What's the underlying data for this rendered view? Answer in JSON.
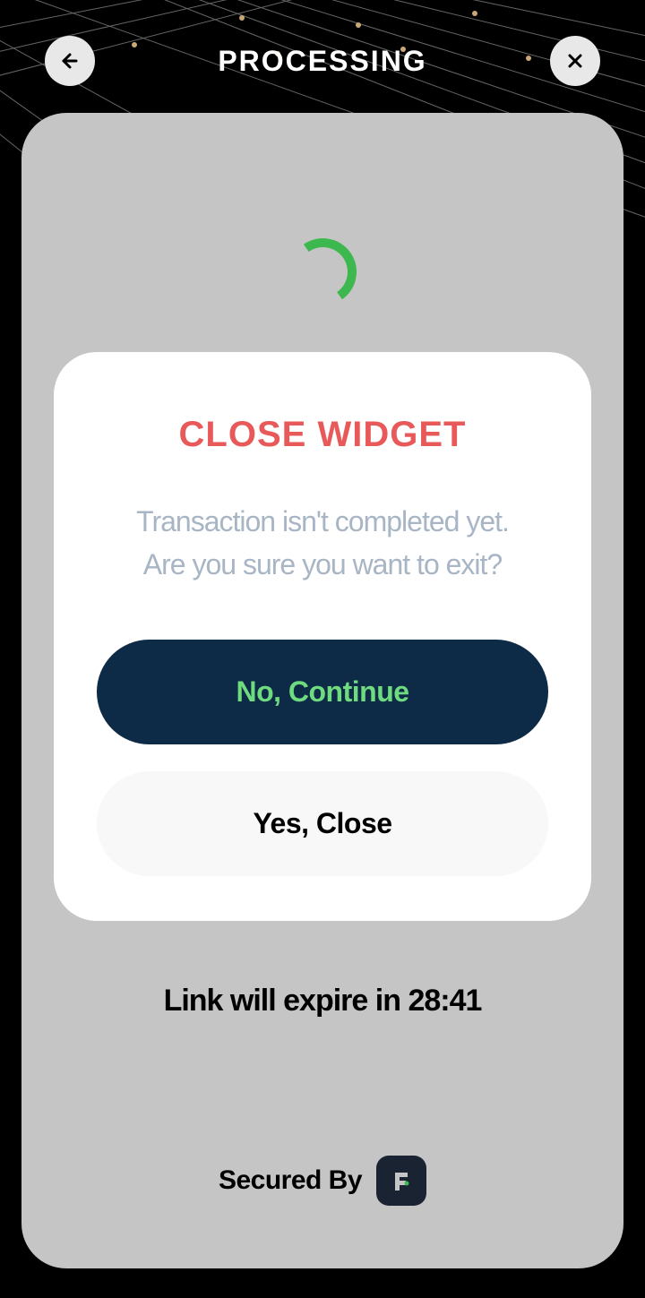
{
  "header": {
    "title": "PROCESSING"
  },
  "modal": {
    "title": "CLOSE WIDGET",
    "message_line1": "Transaction isn't completed yet.",
    "message_line2": "Are you sure you want to exit?",
    "btn_continue": "No, Continue",
    "btn_close": "Yes, Close"
  },
  "expire": {
    "prefix": "Link will expire in ",
    "time": "28:41"
  },
  "footer": {
    "secured_by": "Secured By"
  }
}
